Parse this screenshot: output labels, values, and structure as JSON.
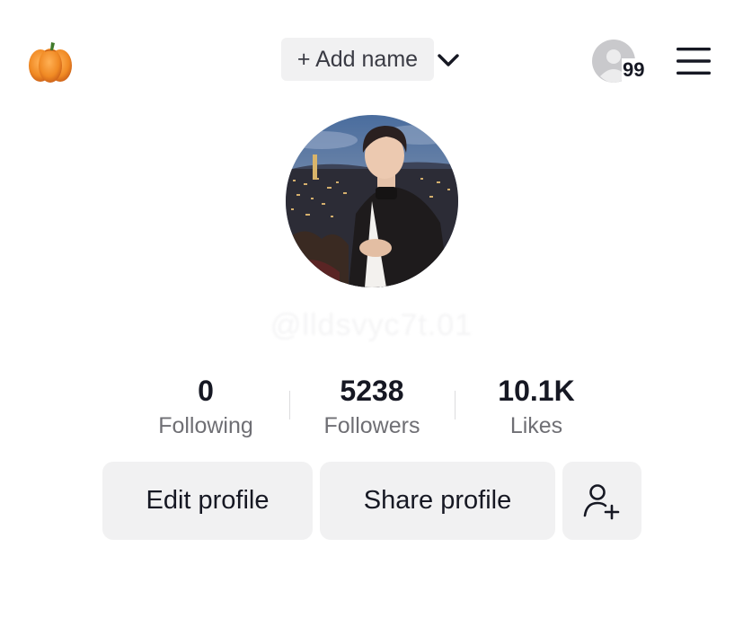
{
  "header": {
    "logo_icon": "pumpkin-icon",
    "add_name_label": "+ Add name",
    "account_switch_icon": "chevron-down-icon",
    "friends_icon": "profile-avatar-icon",
    "friends_count": "99",
    "menu_icon": "hamburger-menu-icon"
  },
  "profile": {
    "avatar_icon": "profile-photo",
    "username": "@lldsvyc7t.01"
  },
  "stats": [
    {
      "value": "0",
      "label": "Following"
    },
    {
      "value": "5238",
      "label": "Followers"
    },
    {
      "value": "10.1K",
      "label": "Likes"
    }
  ],
  "actions": {
    "edit_label": "Edit profile",
    "share_label": "Share profile",
    "add_friend_icon": "add-friend-icon"
  },
  "colors": {
    "button_bg": "#f1f1f2",
    "text_primary": "#161823",
    "text_secondary": "#6f6f74",
    "pumpkin": "#f08a24"
  }
}
